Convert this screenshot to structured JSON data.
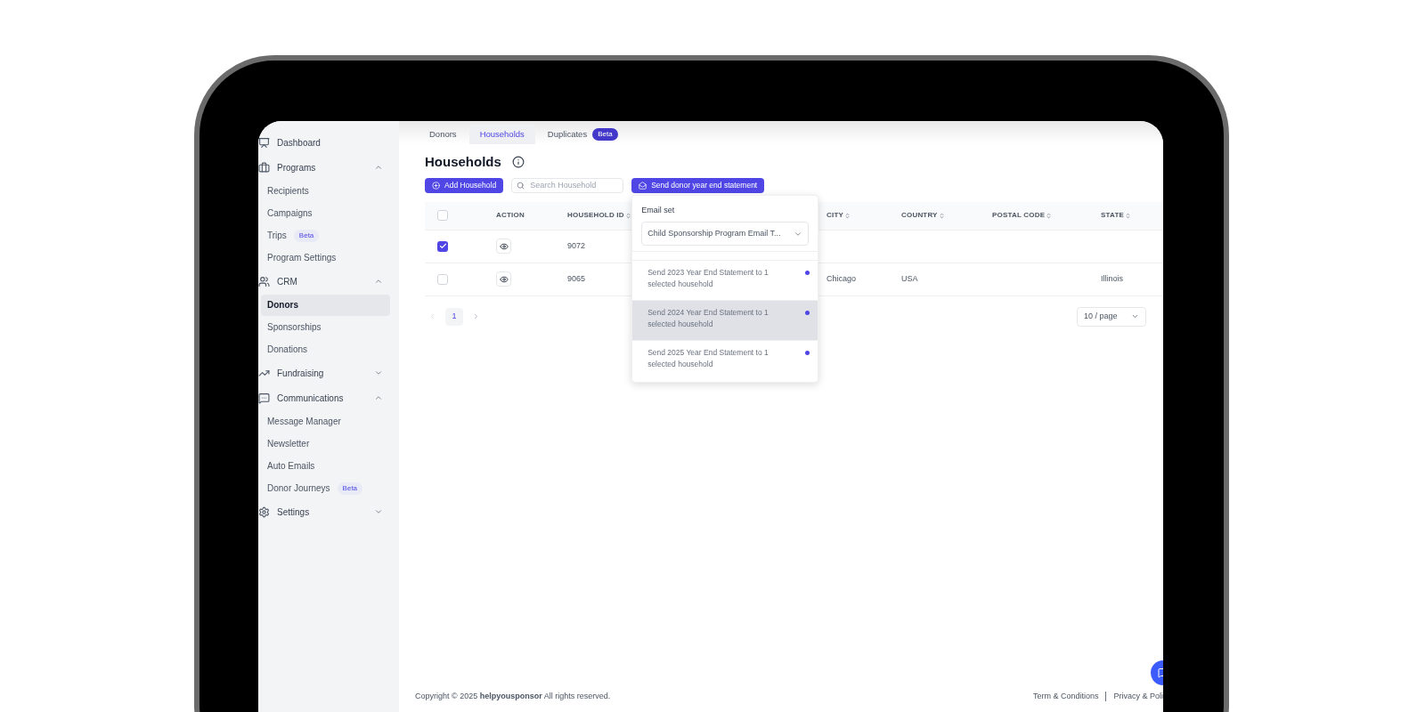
{
  "sidebar": {
    "sections": [
      {
        "label": "Dashboard"
      },
      {
        "label": "Programs",
        "expanded": true,
        "children": [
          {
            "label": "Recipients",
            "selected": false
          },
          {
            "label": "Campaigns",
            "selected": false
          },
          {
            "label": "Trips",
            "selected": false,
            "badge": "Beta"
          },
          {
            "label": "Program Settings",
            "selected": false
          }
        ]
      },
      {
        "label": "CRM",
        "expanded": true,
        "children": [
          {
            "label": "Donors",
            "selected": true
          },
          {
            "label": "Sponsorships",
            "selected": false
          },
          {
            "label": "Donations",
            "selected": false
          }
        ]
      },
      {
        "label": "Fundraising",
        "expanded": false
      },
      {
        "label": "Communications",
        "expanded": true,
        "children": [
          {
            "label": "Message Manager",
            "selected": false
          },
          {
            "label": "Newsletter",
            "selected": false
          },
          {
            "label": "Auto Emails",
            "selected": false
          },
          {
            "label": "Donor Journeys",
            "selected": false,
            "badge": "Beta"
          }
        ]
      },
      {
        "label": "Settings",
        "expanded": false
      }
    ]
  },
  "tabs": [
    {
      "label": "Donors",
      "selected": false
    },
    {
      "label": "Households",
      "selected": true
    },
    {
      "label": "Duplicates",
      "selected": false,
      "badge": "Beta"
    }
  ],
  "title": "Households",
  "toolbar": {
    "add_button": "Add Household",
    "search": {
      "placeholder": "Search Household"
    },
    "send_button": "Send donor year end statement"
  },
  "dropdown": {
    "label": "Email set",
    "select_value": "Child Sponsorship Program Email T...",
    "options": [
      {
        "label": "Send 2023 Year End Statement to 1 selected household",
        "highlighted": false
      },
      {
        "label": "Send 2024 Year End Statement to 1 selected household",
        "highlighted": true
      },
      {
        "label": "Send 2025 Year End Statement to 1 selected household",
        "highlighted": false
      }
    ]
  },
  "table": {
    "select_all_checked": false,
    "columns": [
      {
        "label": "ACTION",
        "sortable": false
      },
      {
        "label": "HOUSEHOLD ID",
        "sortable": true
      },
      {
        "label": "CITY",
        "sortable": true
      },
      {
        "label": "COUNTRY",
        "sortable": true
      },
      {
        "label": "POSTAL CODE",
        "sortable": true
      },
      {
        "label": "STATE",
        "sortable": true
      }
    ],
    "rows": [
      {
        "checked": true,
        "cells": [
          "",
          "9072",
          "",
          "",
          "",
          ""
        ]
      },
      {
        "checked": false,
        "cells": [
          "",
          "9065",
          "Chicago",
          "USA",
          "",
          "Illinois"
        ]
      }
    ]
  },
  "pagination": {
    "pages": [
      {
        "label": "1",
        "selected": true
      }
    ],
    "page_size": "10 / page"
  },
  "footer": {
    "copyright": "Copyright © 2025 **helpyousponsor** All rights reserved.",
    "links": [
      "Term & Conditions",
      "Privacy & Poli"
    ]
  }
}
